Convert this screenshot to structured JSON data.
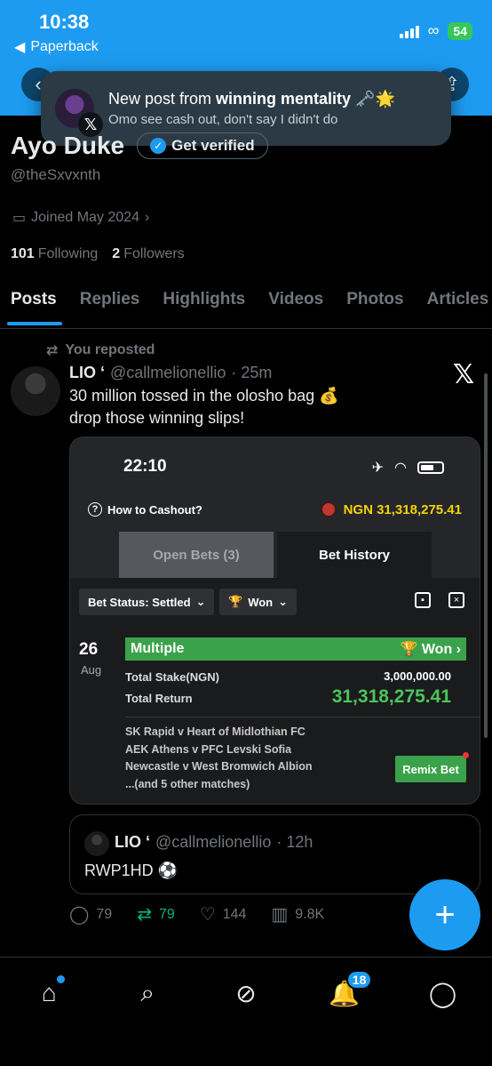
{
  "status_bar": {
    "time": "10:38",
    "back_app": "Paperback",
    "battery": "54"
  },
  "notification": {
    "prefix": "New post from ",
    "author": "winning mentality",
    "emoji": "🗝️🌟",
    "body": "Omo see cash out, don't say I didn't do"
  },
  "profile": {
    "name": "Ayo Duke",
    "verify_label": "Get verified",
    "handle": "@theSxvxnth",
    "joined": "Joined May 2024",
    "following_count": "101",
    "following_label": "Following",
    "followers_count": "2",
    "followers_label": "Followers"
  },
  "tabs": [
    "Posts",
    "Replies",
    "Highlights",
    "Videos",
    "Photos",
    "Articles"
  ],
  "post": {
    "repost_label": "You reposted",
    "author": "LIO ‘",
    "handle": "@callmelionellio",
    "time": "· 25m",
    "text_line1": "30 million tossed in the olosho bag 💰",
    "text_line2": "drop those winning slips!",
    "replies": "79",
    "reposts": "79",
    "likes": "144",
    "views": "9.8K"
  },
  "slip": {
    "time": "22:10",
    "how_to": "How to Cashout?",
    "balance": "NGN 31,318,275.41",
    "tab_open": "Open Bets (3)",
    "tab_history": "Bet History",
    "filter_status": "Bet Status: Settled",
    "filter_won": "Won",
    "day": "26",
    "month": "Aug",
    "bet_type": "Multiple",
    "result": "Won",
    "stake_label": "Total Stake(NGN)",
    "stake_value": "3,000,000.00",
    "return_label": "Total Return",
    "return_value": "31,318,275.41",
    "match1": "SK Rapid v Heart of Midlothian FC",
    "match2": "AEK Athens v PFC Levski Sofia",
    "match3": "Newcastle v West Bromwich Albion",
    "match_more": "...(and 5 other matches)",
    "remix": "Remix Bet"
  },
  "quote": {
    "author": "LIO ‘",
    "handle": "@callmelionellio",
    "time": "· 12h",
    "text": "RWP1HD ⚽"
  },
  "nav": {
    "notifications_badge": "18"
  },
  "colors": {
    "accent": "#1d9bf0",
    "repost_green": "#00ba7c",
    "bet_green": "#3aa24a",
    "balance_yellow": "#f5d400"
  }
}
